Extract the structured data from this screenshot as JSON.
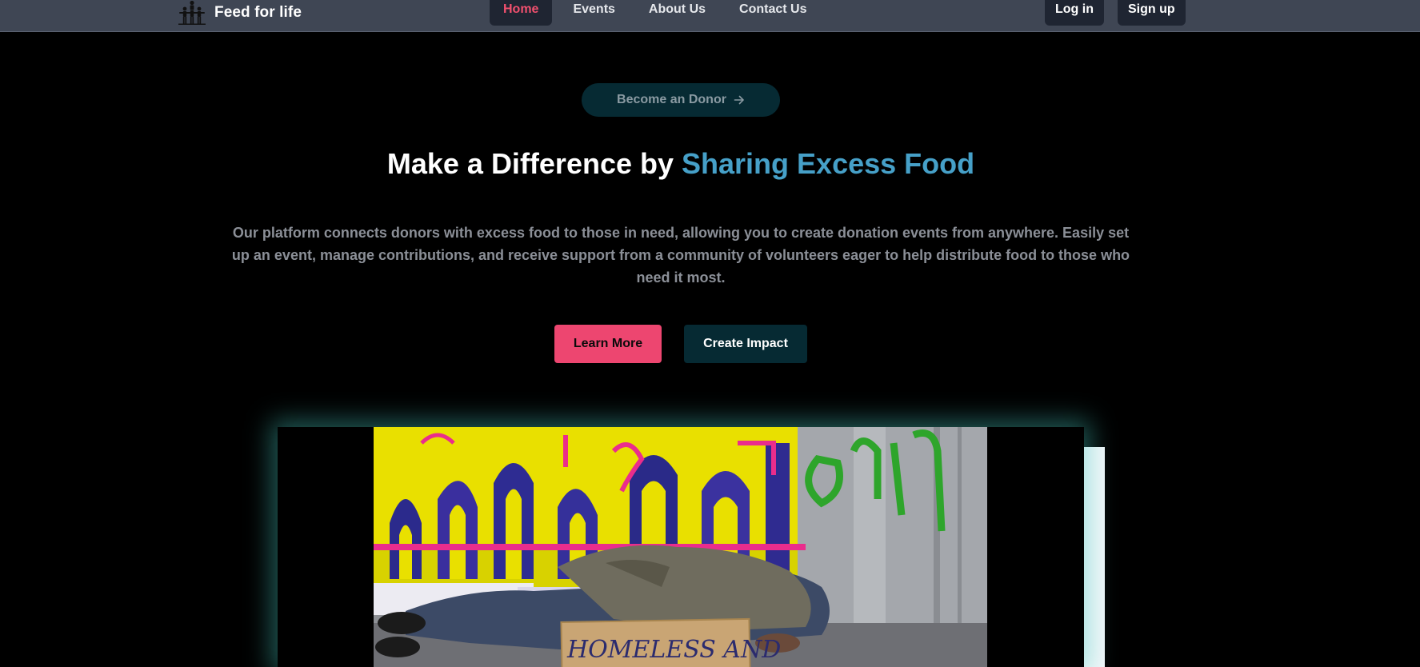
{
  "navbar": {
    "brand_name": "Feed for life",
    "links": [
      {
        "label": "Home",
        "active": true
      },
      {
        "label": "Events",
        "active": false
      },
      {
        "label": "About Us",
        "active": false
      },
      {
        "label": "Contact Us",
        "active": false
      }
    ],
    "login_label": "Log in",
    "signup_label": "Sign up"
  },
  "hero": {
    "pill_label": "Become an Donor",
    "pill_icon": "arrow-right-icon",
    "headline_plain": "Make a Difference by ",
    "headline_accent": "Sharing Excess Food",
    "description": "Our platform connects donors with excess food to those in need, allowing you to create donation events from anywhere. Easily set up an event, manage contributions, and receive support from a community of volunteers eager to help distribute food to those who need it most.",
    "primary_button": "Learn More",
    "secondary_button": "Create Impact"
  },
  "media": {
    "sign_text": "HOMELESS AND"
  },
  "colors": {
    "navbar_bg": "#3f4654",
    "active_link": "#f0506e",
    "accent": "#46a0c8",
    "primary_button": "#ed4670",
    "secondary_button": "#062a33",
    "glow": "#46c8be"
  }
}
